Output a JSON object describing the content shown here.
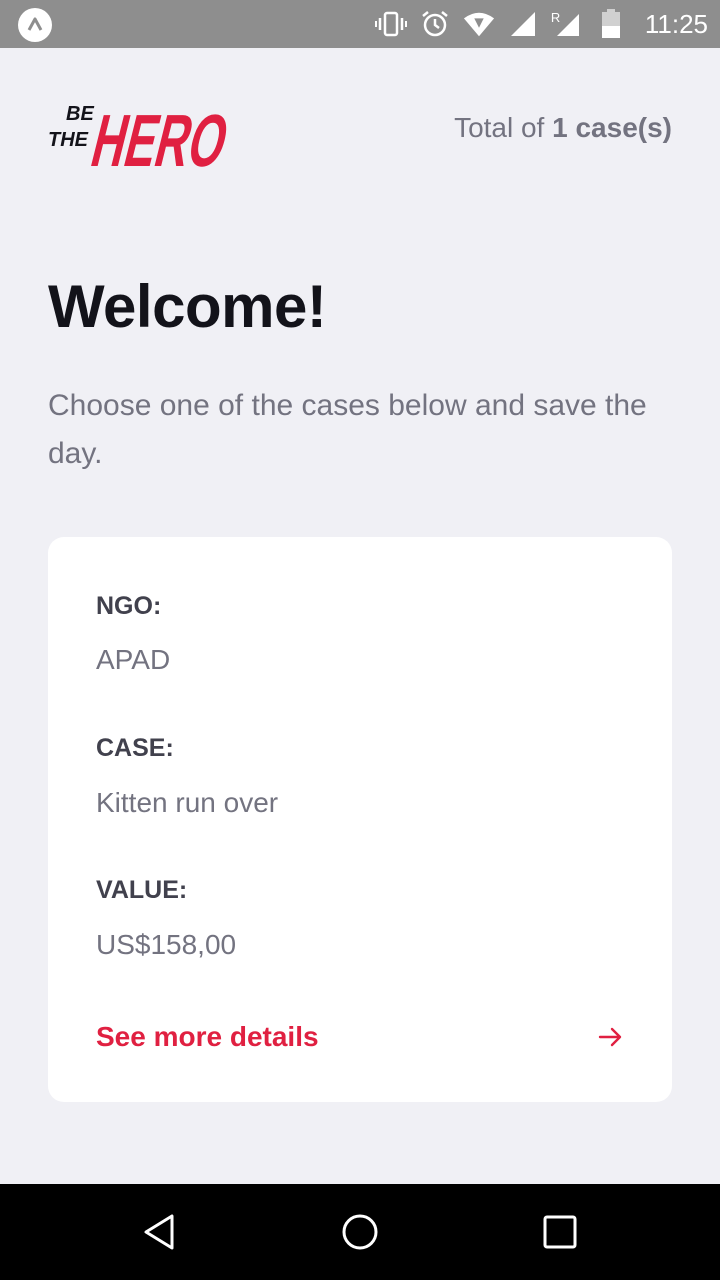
{
  "status_bar": {
    "time": "11:25",
    "icons": [
      "app-icon",
      "vibrate-icon",
      "alarm-icon",
      "wifi-icon",
      "signal-icon",
      "signal-roaming-icon",
      "battery-icon"
    ],
    "roaming_label": "R"
  },
  "header": {
    "logo_text_be": "BE",
    "logo_text_the": "THE",
    "logo_text_hero": "HERO",
    "total_prefix": "Total of ",
    "total_count": "1 case(s)"
  },
  "title": "Welcome!",
  "subtitle": "Choose one of the cases below and save the day.",
  "incidents": [
    {
      "ngo_label": "NGO:",
      "ngo_value": "APAD",
      "case_label": "CASE:",
      "case_value": "Kitten run over",
      "value_label": "VALUE:",
      "value_value": "US$158,00",
      "details_label": "See more details"
    }
  ],
  "colors": {
    "brand_red": "#e02041",
    "background": "#f0f0f5",
    "text_dark": "#13131a",
    "text_gray": "#737380",
    "label_dark": "#41414d"
  },
  "nav": {
    "icons": [
      "back-icon",
      "home-icon",
      "recents-icon"
    ]
  }
}
